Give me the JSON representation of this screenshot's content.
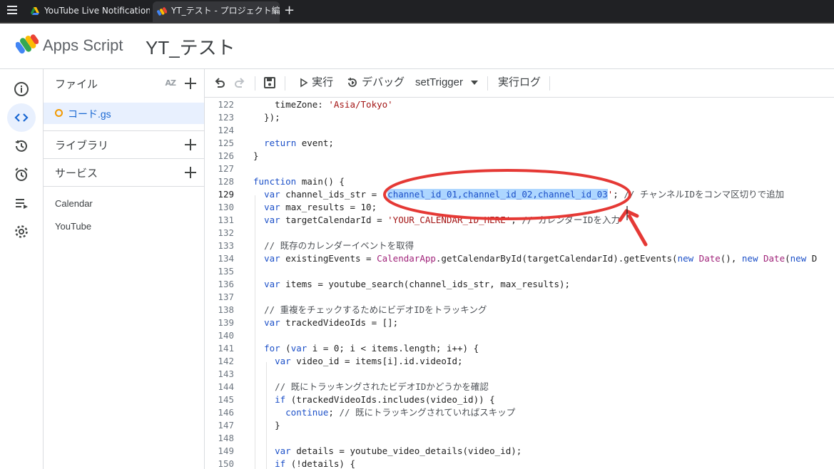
{
  "browser": {
    "tabs": [
      {
        "title": "YouTube Live Notification -"
      },
      {
        "title": "YT_テスト - プロジェクト編集者"
      }
    ],
    "new_tab": "+"
  },
  "header": {
    "app_name": "Apps Script",
    "project_name": "YT_テスト"
  },
  "rail": {
    "items": [
      "info-icon",
      "code-icon",
      "history-icon",
      "alarm-icon",
      "executions-icon",
      "settings-icon"
    ],
    "active": "code-icon"
  },
  "files_panel": {
    "files_title": "ファイル",
    "sort_label": "AZ",
    "files": [
      {
        "name": "コード.gs"
      }
    ],
    "libraries_title": "ライブラリ",
    "services_title": "サービス",
    "services": [
      "Calendar",
      "YouTube"
    ]
  },
  "toolbar": {
    "run_label": "実行",
    "debug_label": "デバッグ",
    "function_selected": "setTrigger",
    "log_label": "実行ログ"
  },
  "editor": {
    "lines": [
      {
        "n": "122",
        "text": "    timeZone: 'Asia/Tokyo'"
      },
      {
        "n": "123",
        "text": "  });"
      },
      {
        "n": "124",
        "text": ""
      },
      {
        "n": "125",
        "text": "  return event;"
      },
      {
        "n": "126",
        "text": "}"
      },
      {
        "n": "127",
        "text": ""
      },
      {
        "n": "128",
        "text": "function main() {"
      },
      {
        "n": "129",
        "text": "  var channel_ids_str = 'channel_id_01,channel_id_02,channel_id_03'; // チャンネルIDをコンマ区切りで追加"
      },
      {
        "n": "130",
        "text": "  var max_results = 10;"
      },
      {
        "n": "131",
        "text": "  var targetCalendarId = 'YOUR_CALENDAR_ID_HERE'; // カレンダーIDを入力"
      },
      {
        "n": "132",
        "text": ""
      },
      {
        "n": "133",
        "text": "  // 既存のカレンダーイベントを取得"
      },
      {
        "n": "134",
        "text": "  var existingEvents = CalendarApp.getCalendarById(targetCalendarId).getEvents(new Date(), new Date(new D"
      },
      {
        "n": "135",
        "text": ""
      },
      {
        "n": "136",
        "text": "  var items = youtube_search(channel_ids_str, max_results);"
      },
      {
        "n": "137",
        "text": ""
      },
      {
        "n": "138",
        "text": "  // 重複をチェックするためにビデオIDをトラッキング"
      },
      {
        "n": "139",
        "text": "  var trackedVideoIds = [];"
      },
      {
        "n": "140",
        "text": ""
      },
      {
        "n": "141",
        "text": "  for (var i = 0; i < items.length; i++) {"
      },
      {
        "n": "142",
        "text": "    var video_id = items[i].id.videoId;"
      },
      {
        "n": "143",
        "text": ""
      },
      {
        "n": "144",
        "text": "    // 既にトラッキングされたビデオIDかどうかを確認"
      },
      {
        "n": "145",
        "text": "    if (trackedVideoIds.includes(video_id)) {"
      },
      {
        "n": "146",
        "text": "      continue; // 既にトラッキングされていればスキップ"
      },
      {
        "n": "147",
        "text": "    }"
      },
      {
        "n": "148",
        "text": ""
      },
      {
        "n": "149",
        "text": "    var details = youtube_video_details(video_id);"
      },
      {
        "n": "150",
        "text": "    if (!details) {"
      }
    ],
    "selected_text": "channel_id_01,channel_id_02,channel_id_03"
  },
  "colors": {
    "accent": "#1967d2",
    "annotation": "#e53935",
    "selection": "#add6ff"
  }
}
